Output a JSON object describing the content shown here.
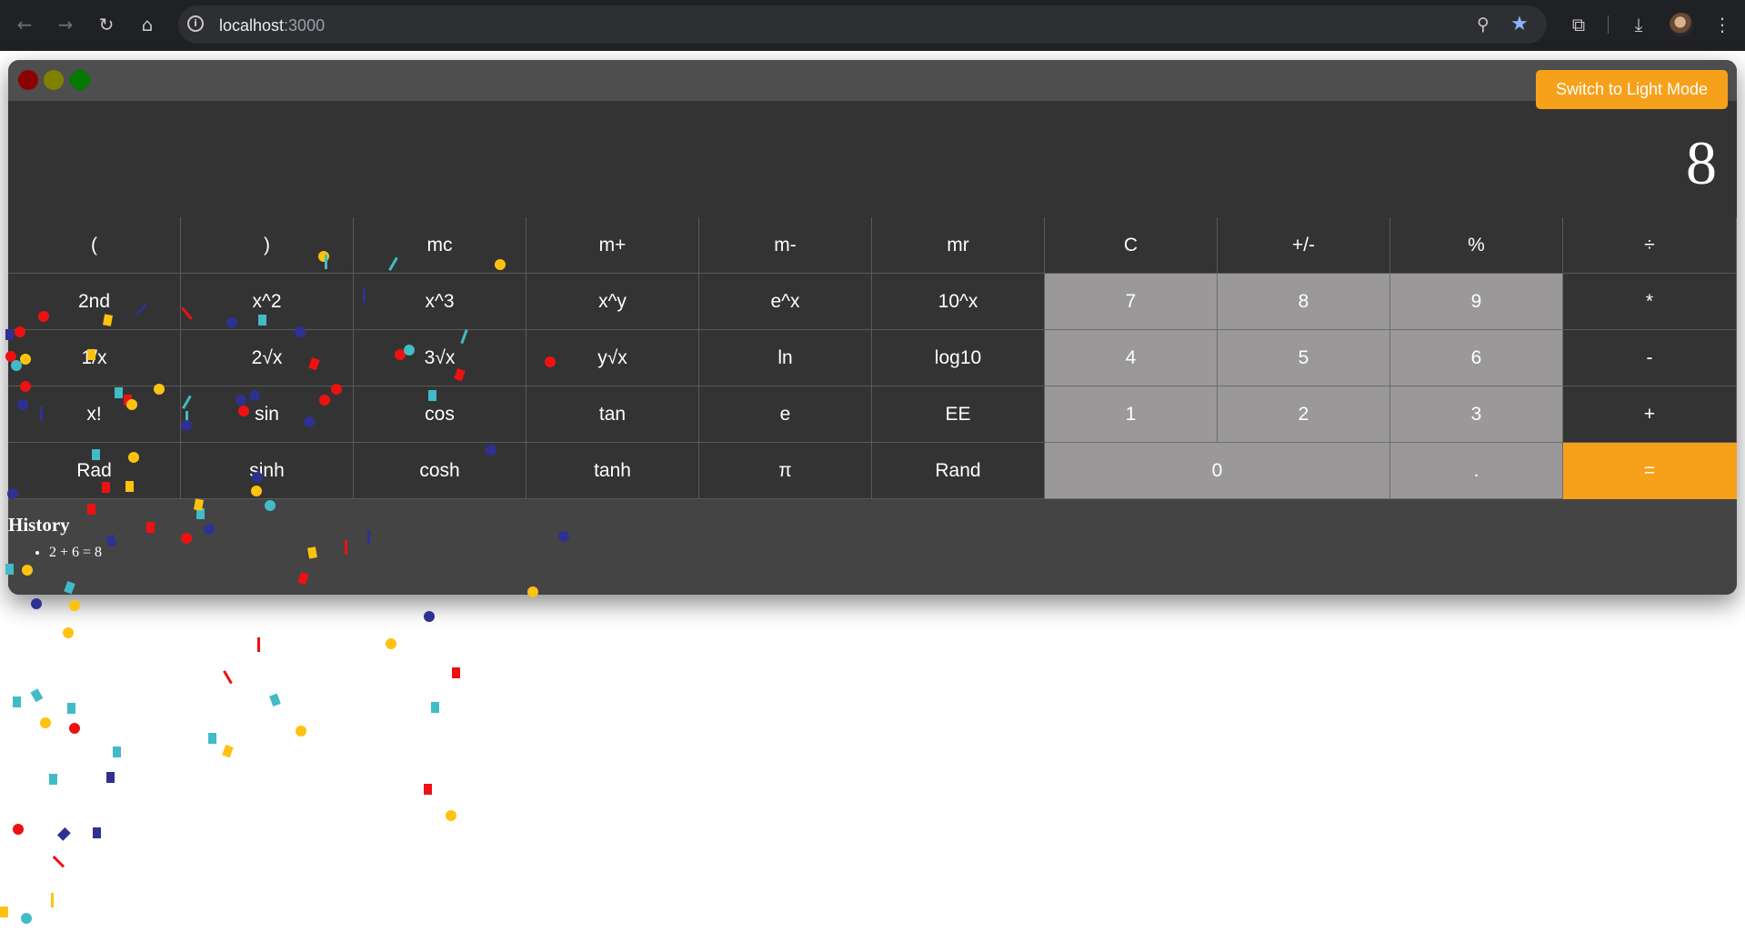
{
  "browser": {
    "url_host": "localhost",
    "url_port": ":3000",
    "icons": {
      "back": "arrow-left-icon",
      "forward": "arrow-right-icon",
      "reload": "reload-icon",
      "home": "home-icon",
      "site_info": "info-icon",
      "zoom": "zoom-icon",
      "bookmark": "star-icon",
      "extensions": "puzzle-icon",
      "downloads": "download-icon",
      "menu": "kebab-menu-icon"
    }
  },
  "calculator": {
    "mode_button_label": "Switch to Light Mode",
    "display_value": "8",
    "keys": [
      {
        "label": "(",
        "kind": "fn"
      },
      {
        "label": ")",
        "kind": "fn"
      },
      {
        "label": "mc",
        "kind": "fn"
      },
      {
        "label": "m+",
        "kind": "fn"
      },
      {
        "label": "m-",
        "kind": "fn"
      },
      {
        "label": "mr",
        "kind": "fn"
      },
      {
        "label": "C",
        "kind": "fn"
      },
      {
        "label": "+/-",
        "kind": "fn"
      },
      {
        "label": "%",
        "kind": "fn"
      },
      {
        "label": "÷",
        "kind": "op"
      },
      {
        "label": "2nd",
        "kind": "fn"
      },
      {
        "label": "x^2",
        "kind": "fn"
      },
      {
        "label": "x^3",
        "kind": "fn"
      },
      {
        "label": "x^y",
        "kind": "fn"
      },
      {
        "label": "e^x",
        "kind": "fn"
      },
      {
        "label": "10^x",
        "kind": "fn"
      },
      {
        "label": "7",
        "kind": "num"
      },
      {
        "label": "8",
        "kind": "num"
      },
      {
        "label": "9",
        "kind": "num"
      },
      {
        "label": "*",
        "kind": "op"
      },
      {
        "label": "1/x",
        "kind": "fn"
      },
      {
        "label": "2√x",
        "kind": "fn"
      },
      {
        "label": "3√x",
        "kind": "fn"
      },
      {
        "label": "y√x",
        "kind": "fn"
      },
      {
        "label": "ln",
        "kind": "fn"
      },
      {
        "label": "log10",
        "kind": "fn"
      },
      {
        "label": "4",
        "kind": "num"
      },
      {
        "label": "5",
        "kind": "num"
      },
      {
        "label": "6",
        "kind": "num"
      },
      {
        "label": "-",
        "kind": "op"
      },
      {
        "label": "x!",
        "kind": "fn"
      },
      {
        "label": "sin",
        "kind": "fn"
      },
      {
        "label": "cos",
        "kind": "fn"
      },
      {
        "label": "tan",
        "kind": "fn"
      },
      {
        "label": "e",
        "kind": "fn"
      },
      {
        "label": "EE",
        "kind": "fn"
      },
      {
        "label": "1",
        "kind": "num"
      },
      {
        "label": "2",
        "kind": "num"
      },
      {
        "label": "3",
        "kind": "num"
      },
      {
        "label": "+",
        "kind": "op"
      },
      {
        "label": "Rad",
        "kind": "fn"
      },
      {
        "label": "sinh",
        "kind": "fn"
      },
      {
        "label": "cosh",
        "kind": "fn"
      },
      {
        "label": "tanh",
        "kind": "fn"
      },
      {
        "label": "π",
        "kind": "fn"
      },
      {
        "label": "Rand",
        "kind": "fn"
      },
      {
        "label": "0",
        "kind": "zero"
      },
      {
        "label": ".",
        "kind": "num"
      },
      {
        "label": "=",
        "kind": "equals"
      }
    ],
    "history": {
      "title": "History",
      "entries": [
        "2 + 6 = 8"
      ]
    }
  },
  "colors": {
    "accent": "#f7a11a",
    "display_bg": "#333333",
    "number_key_bg": "#9a9898",
    "window_bg": "#444444",
    "confetti": [
      "#ffc20e",
      "#ee1111",
      "#2e3192",
      "#41bbc7"
    ]
  }
}
